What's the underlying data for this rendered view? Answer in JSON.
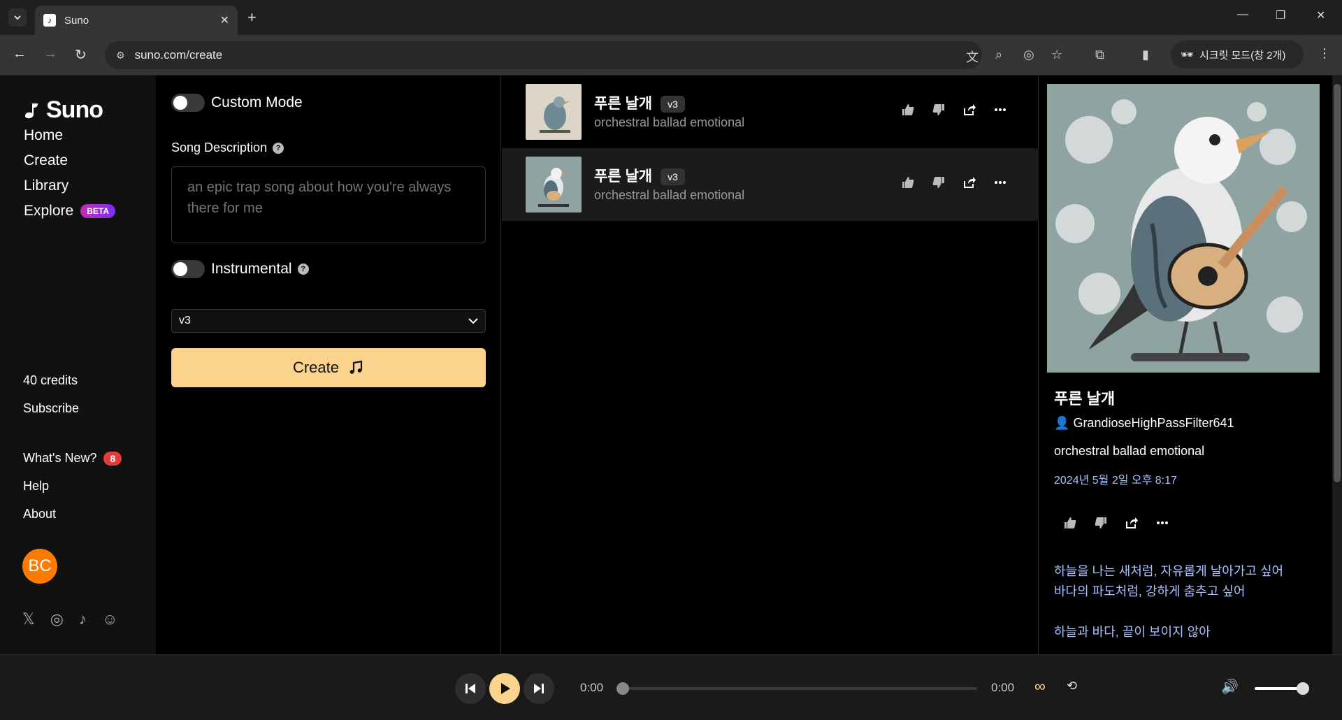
{
  "browser": {
    "tab_title": "Suno",
    "url": "suno.com/create",
    "incognito_label": "시크릿 모드(창 2개)"
  },
  "sidebar": {
    "logo": "Suno",
    "nav": [
      {
        "label": "Home"
      },
      {
        "label": "Create"
      },
      {
        "label": "Library"
      },
      {
        "label": "Explore",
        "badge": "BETA"
      }
    ],
    "credits": "40 credits",
    "subscribe": "Subscribe",
    "whats_new": "What's New?",
    "whats_new_count": "8",
    "help": "Help",
    "about": "About",
    "avatar_initials": "BC",
    "socials": [
      "x-icon",
      "instagram-icon",
      "tiktok-icon",
      "discord-icon"
    ]
  },
  "form": {
    "custom_mode_label": "Custom Mode",
    "song_description_label": "Song Description",
    "song_description_placeholder": "an epic trap song about how you're always there for me",
    "instrumental_label": "Instrumental",
    "model_selected": "v3",
    "create_label": "Create"
  },
  "songs": [
    {
      "title": "푸른 날개",
      "version": "v3",
      "tags": "orchestral ballad emotional"
    },
    {
      "title": "푸른 날개",
      "version": "v3",
      "tags": "orchestral ballad emotional"
    }
  ],
  "detail": {
    "title": "푸른 날개",
    "user": "GrandioseHighPassFilter641",
    "tags": "orchestral ballad emotional",
    "date": "2024년 5월 2일 오후 8:17",
    "lyrics": [
      "하늘을 나는 새처럼, 자유롭게 날아가고 싶어",
      "바다의 파도처럼, 강하게 춤추고 싶어",
      "",
      "하늘과 바다, 끝이 보이지 않아"
    ]
  },
  "player": {
    "time_current": "0:00",
    "time_total": "0:00",
    "progress": 0,
    "volume": 1
  },
  "colors": {
    "accent": "#fcd38c",
    "beta_gradient_start": "#c12fb2",
    "badge_red": "#e23b3b",
    "avatar": "#ff7a00",
    "link_blue": "#a9c1ff"
  }
}
